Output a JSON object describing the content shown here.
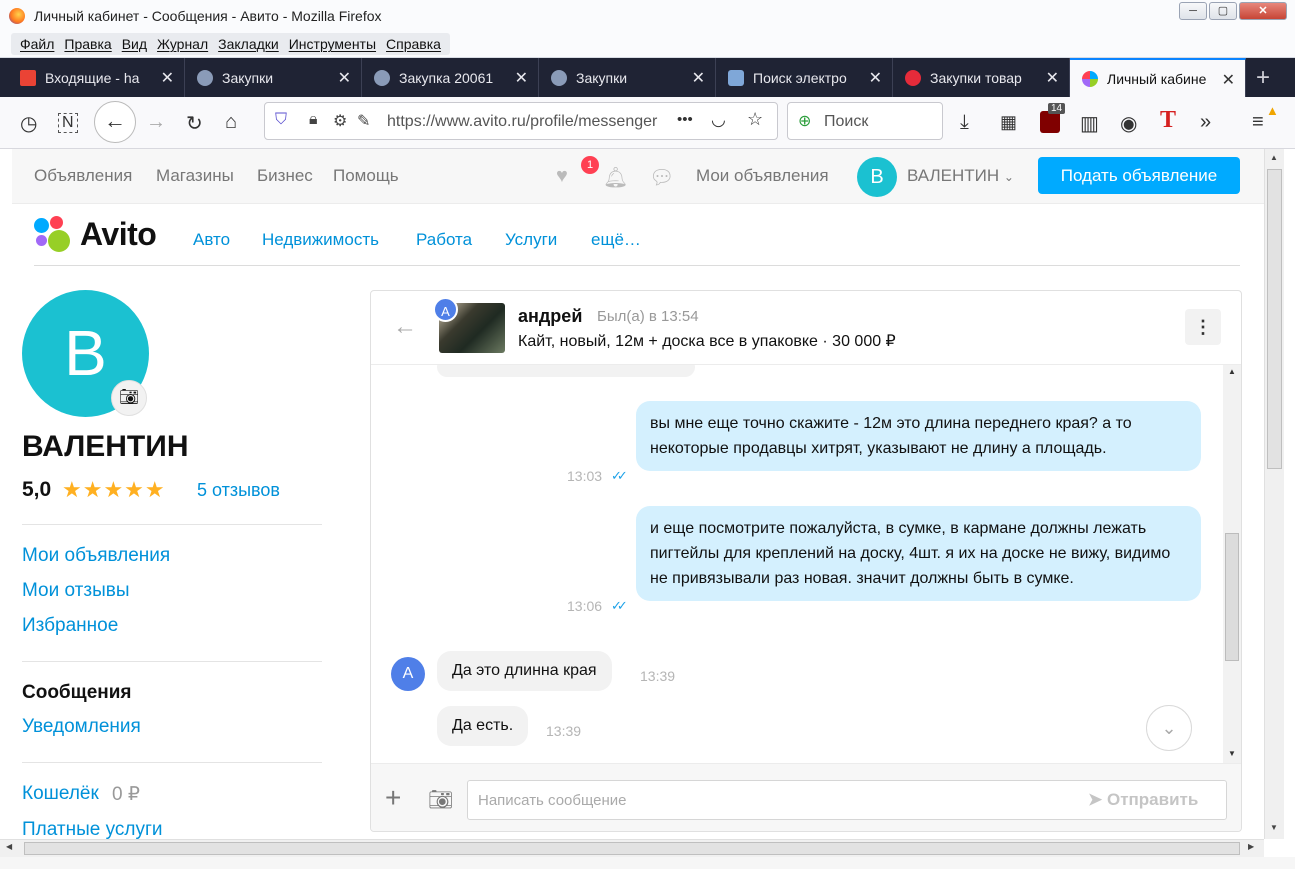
{
  "window": {
    "title": "Личный кабинет - Сообщения - Авито - Mozilla Firefox",
    "controls": {
      "minimize": "─",
      "maximize": "▢",
      "close": "✕"
    }
  },
  "menu": [
    "Файл",
    "Правка",
    "Вид",
    "Журнал",
    "Закладки",
    "Инструменты",
    "Справка"
  ],
  "tabs": [
    {
      "label": "Входящие - ha",
      "icon": "gmail-icon",
      "color": "#ea4335"
    },
    {
      "label": "Закупки",
      "icon": "tender-icon",
      "color": "#8a9bb8"
    },
    {
      "label": "Закупка 20061",
      "icon": "tender-icon",
      "color": "#8a9bb8"
    },
    {
      "label": "Закупки",
      "icon": "tender-icon",
      "color": "#8a9bb8"
    },
    {
      "label": "Поиск электро",
      "icon": "search-engine-icon",
      "color": "#7fa7d8"
    },
    {
      "label": "Закупки товар",
      "icon": "red-circle-icon",
      "color": "#e52b3a"
    },
    {
      "label": "Личный кабине",
      "icon": "avito-icon",
      "color": "#97cf26",
      "active": true
    }
  ],
  "toolbar": {
    "url": "https://www.avito.ru/profile/messenger",
    "search_placeholder": "Поиск",
    "ublock_count": "14",
    "more": "•••"
  },
  "avito_header": {
    "links": [
      "Объявления",
      "Магазины",
      "Бизнес",
      "Помощь"
    ],
    "favorites_badge": "1",
    "my_ads": "Мои объявления",
    "user_initial": "В",
    "user_name": "ВАЛЕНТИН",
    "post_button": "Подать объявление"
  },
  "logo_text": "Avito",
  "categories": [
    "Авто",
    "Недвижимость",
    "Работа",
    "Услуги",
    "ещё…"
  ],
  "profile": {
    "initial": "В",
    "name": "ВАЛЕНТИН",
    "rating": "5,0",
    "stars": "★★★★★",
    "reviews": "5 отзывов"
  },
  "sidebar": {
    "group1": [
      "Мои объявления",
      "Мои отзывы",
      "Избранное"
    ],
    "group2": [
      "Сообщения",
      "Уведомления"
    ],
    "wallet_label": "Кошелёк",
    "wallet_value": "0 ₽",
    "paid_services": "Платные услуги"
  },
  "chat": {
    "contact_initial": "А",
    "contact_name": "андрей",
    "status": "Был(а) в 13:54",
    "item": "Кайт, новый, 12м + доска все в упаковке · 30 000 ₽",
    "messages_out": [
      {
        "text": "вы мне еще точно скажите - 12м это длина переднего края? а то некоторые продавцы хитрят, указывают  не длину а площадь.",
        "time": "13:03",
        "read": "✓✓"
      },
      {
        "text": "и еще посмотрите пожалуйста, в сумке, в кармане должны лежать пигтейлы для креплений на доску, 4шт. я их на доске не вижу, видимо не привязывали раз новая. значит должны быть в сумке.",
        "time": "13:06",
        "read": "✓✓"
      }
    ],
    "messages_in": [
      {
        "text": "Да это длинна края",
        "time": "13:39"
      },
      {
        "text": "Да есть.",
        "time": "13:39"
      }
    ],
    "input_placeholder": "Написать сообщение",
    "send_label": "Отправить"
  }
}
